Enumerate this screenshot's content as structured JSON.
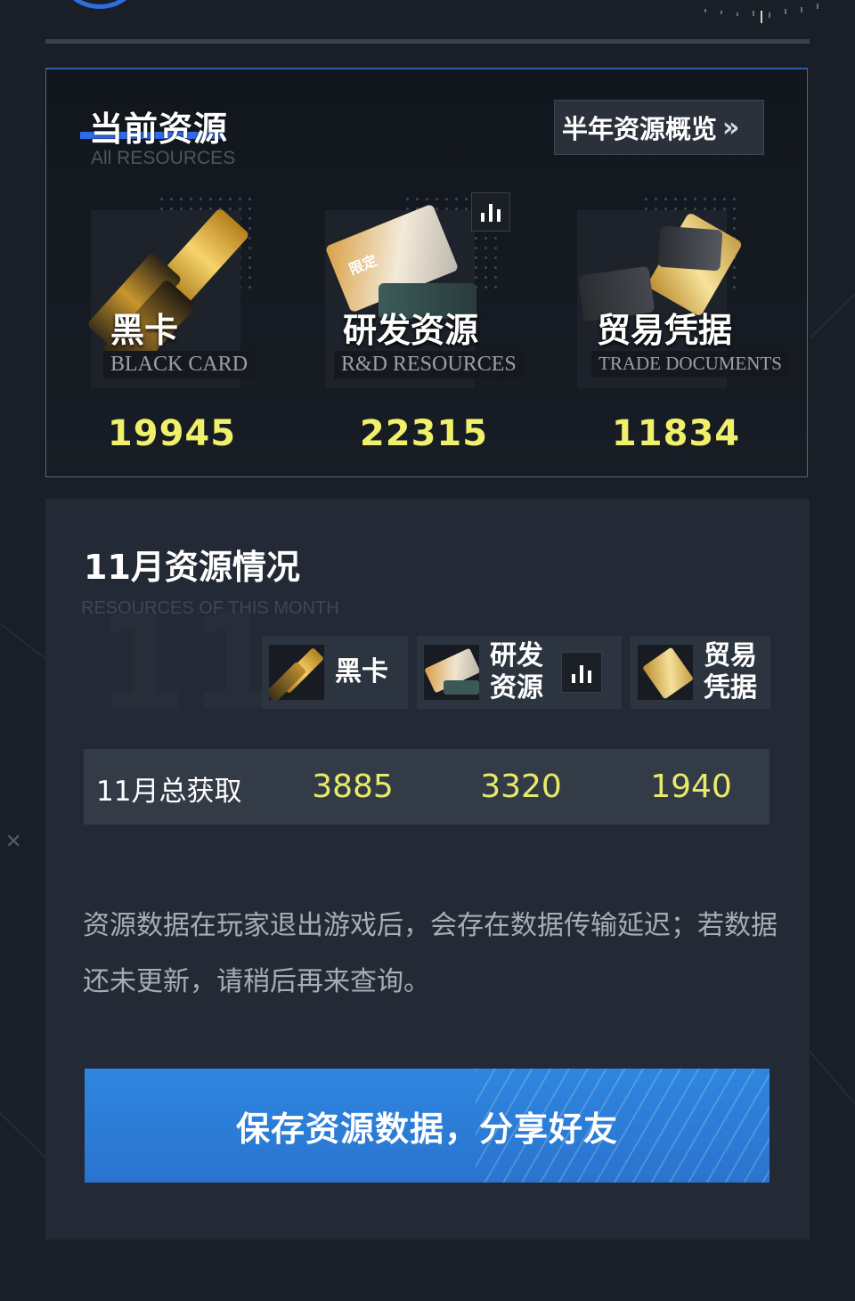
{
  "current": {
    "title": "当前资源",
    "subtitle": "All RESOURCES",
    "overview_label": "半年资源概览",
    "overview_chevron": "»",
    "cards": [
      {
        "name": "黑卡",
        "en": "BLACK CARD",
        "value": "19945"
      },
      {
        "name": "研发资源",
        "en": "R&D RESOURCES",
        "value": "22315",
        "art_text": "限定"
      },
      {
        "name": "贸易凭据",
        "en": "TRADE DOCUMENTS",
        "value": "11834"
      }
    ]
  },
  "month": {
    "title": "11月资源情况",
    "subtitle": "RESOURCES OF THIS MONTH",
    "watermark": "11",
    "headers": [
      {
        "label": "黑卡"
      },
      {
        "label": "研发资源"
      },
      {
        "label": "贸易凭据"
      }
    ],
    "row": {
      "label": "11月总获取",
      "values": [
        "3885",
        "3320",
        "1940"
      ]
    }
  },
  "notice": "资源数据在玩家退出游戏后，会存在数据传输延迟；若数据还未更新，请稍后再来查询。",
  "share_button": "保存资源数据，分享好友",
  "colors": {
    "value_yellow": "#f0f06a",
    "accent_blue": "#2f6be8",
    "button_blue": "#2e86df"
  },
  "icons": [
    "chart-bar-icon",
    "double-chevron-right-icon",
    "close-icon"
  ]
}
